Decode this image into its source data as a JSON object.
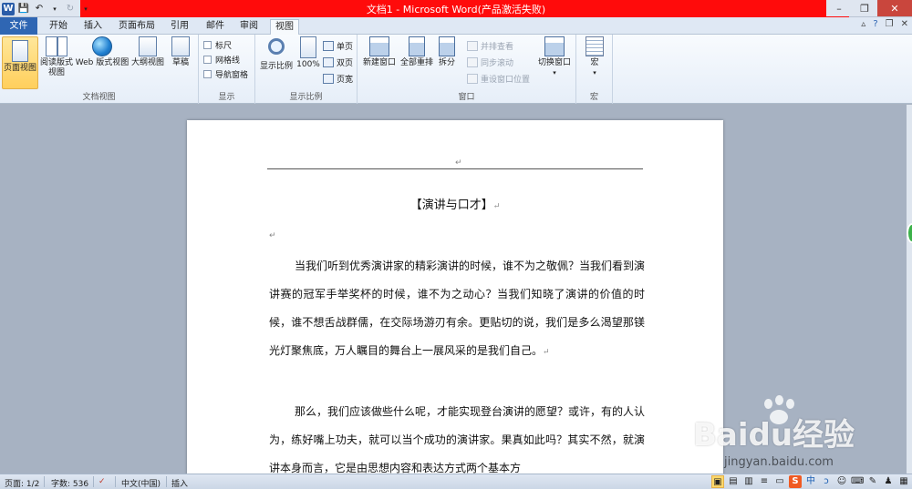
{
  "window": {
    "title": "文档1 - Microsoft Word(产品激活失败)"
  },
  "qat": {
    "undo_icon": "undo-icon",
    "redo_icon": "redo-icon",
    "save_icon": "save-icon"
  },
  "tabs": [
    {
      "label": "文件"
    },
    {
      "label": "开始"
    },
    {
      "label": "插入"
    },
    {
      "label": "页面布局"
    },
    {
      "label": "引用"
    },
    {
      "label": "邮件"
    },
    {
      "label": "审阅"
    },
    {
      "label": "视图"
    }
  ],
  "ribbon": {
    "doc_views": {
      "group_label": "文档视图",
      "print_layout": "页面视图",
      "full_reading_1": "阅读版式",
      "full_reading_2": "视图",
      "web_layout": "Web 版式视图",
      "outline": "大纲视图",
      "draft": "草稿"
    },
    "show": {
      "group_label": "显示",
      "ruler": "标尺",
      "gridlines": "网格线",
      "nav_pane": "导航窗格"
    },
    "zoom": {
      "group_label": "显示比例",
      "zoom": "显示比例",
      "hundred": "100%",
      "one_page": "单页",
      "two_pages": "双页",
      "page_width": "页宽"
    },
    "window": {
      "group_label": "窗口",
      "new_window": "新建窗口",
      "arrange_all": "全部重排",
      "split": "拆分",
      "side_by_side": "并排查看",
      "sync_scroll": "同步滚动",
      "reset_position": "重设窗口位置",
      "switch_windows": "切换窗口"
    },
    "macros": {
      "group_label": "宏",
      "macros": "宏"
    }
  },
  "document": {
    "title": "【演讲与口才】",
    "paragraph1": "当我们听到优秀演讲家的精彩演讲的时候，谁不为之敬佩？当我们看到演讲赛的冠军手举奖杯的时候，谁不为之动心？当我们知晓了演讲的价值的时候，谁不想舌战群儒，在交际场游刃有余。更贴切的说，我们是多么渴望那镁光灯聚焦底，万人瞩目的舞台上一展风采的是我们自己。",
    "paragraph2": "那么，我们应该做些什么呢，才能实现登台演讲的愿望？或许，有的人认为，练好嘴上功夫，就可以当个成功的演讲家。果真如此吗？其实不然，就演讲本身而言，它是由思想内容和表达方式两个基本方",
    "para_mark": "↵"
  },
  "status": {
    "page": "页面: 1/2",
    "words": "字数: 536",
    "language": "中文(中国)",
    "mode": "插入"
  },
  "watermark": {
    "brand": "Baidu经验",
    "url": "jingyan.baidu.com"
  },
  "tray": [
    "中",
    "ↄ",
    "☺",
    "⌨",
    "✎",
    "♟",
    "▦"
  ]
}
